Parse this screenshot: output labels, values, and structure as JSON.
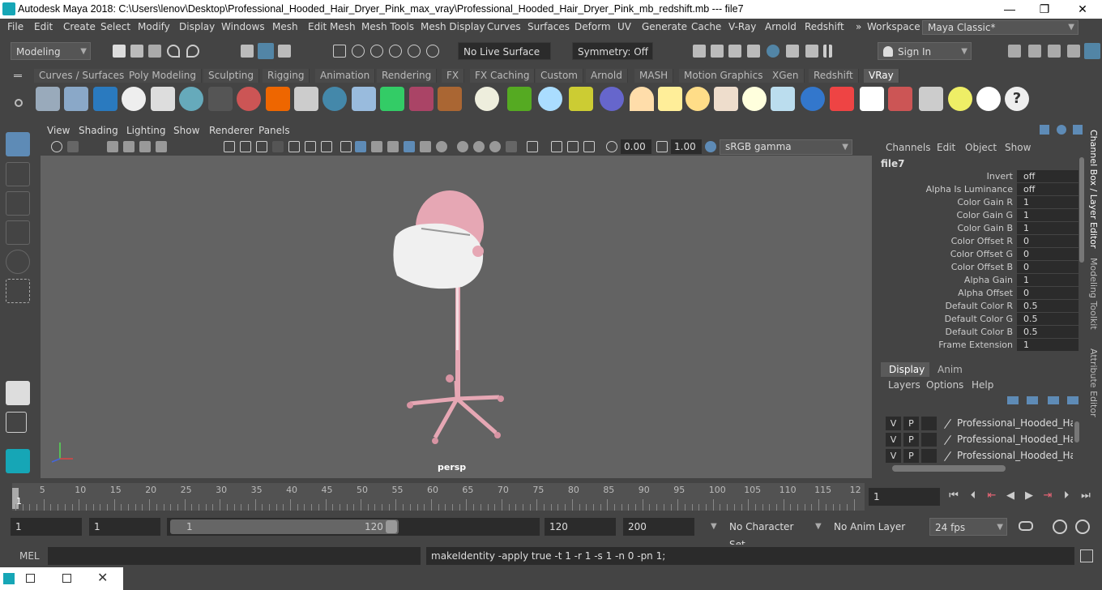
{
  "window": {
    "title": "Autodesk Maya 2018: C:\\Users\\lenov\\Desktop\\Professional_Hooded_Hair_Dryer_Pink_max_vray\\Professional_Hooded_Hair_Dryer_Pink_mb_redshift.mb  ---  file7",
    "minimize": "—",
    "maximize": "❐",
    "close": "✕"
  },
  "menubar": {
    "items": [
      "File",
      "Edit",
      "Create",
      "Select",
      "Modify",
      "Display",
      "Windows",
      "Mesh",
      "Edit Mesh",
      "Mesh Tools",
      "Mesh Display",
      "Curves",
      "Surfaces",
      "Deform",
      "UV",
      "Generate",
      "Cache",
      "V-Ray",
      "Arnold",
      "Redshift"
    ],
    "overflow": "»",
    "workspace_label": "Workspace :",
    "workspace_value": "Maya Classic*"
  },
  "statusline": {
    "mode": "Modeling",
    "live_surface": "No Live Surface",
    "symmetry": "Symmetry: Off",
    "sign_in": "Sign In"
  },
  "shelf": {
    "tabs": [
      "Curves / Surfaces",
      "Poly Modeling",
      "Sculpting",
      "Rigging",
      "Animation",
      "Rendering",
      "FX",
      "FX Caching",
      "Custom",
      "Arnold",
      "MASH",
      "Motion Graphics",
      "XGen",
      "Redshift",
      "VRay"
    ],
    "active": "VRay"
  },
  "viewport": {
    "menus": [
      "View",
      "Shading",
      "Lighting",
      "Show",
      "Renderer",
      "Panels"
    ],
    "exposure": "0.00",
    "gamma": "1.00",
    "colorspace": "sRGB gamma",
    "camera": "persp"
  },
  "channelbox": {
    "tabs": [
      "Channels",
      "Edit",
      "Object",
      "Show"
    ],
    "node": "file7",
    "attrs": [
      {
        "name": "Invert",
        "value": "off"
      },
      {
        "name": "Alpha Is Luminance",
        "value": "off"
      },
      {
        "name": "Color Gain R",
        "value": "1"
      },
      {
        "name": "Color Gain G",
        "value": "1"
      },
      {
        "name": "Color Gain B",
        "value": "1"
      },
      {
        "name": "Color Offset R",
        "value": "0"
      },
      {
        "name": "Color Offset G",
        "value": "0"
      },
      {
        "name": "Color Offset B",
        "value": "0"
      },
      {
        "name": "Alpha Gain",
        "value": "1"
      },
      {
        "name": "Alpha Offset",
        "value": "0"
      },
      {
        "name": "Default Color R",
        "value": "0.5"
      },
      {
        "name": "Default Color G",
        "value": "0.5"
      },
      {
        "name": "Default Color B",
        "value": "0.5"
      },
      {
        "name": "Frame Extension",
        "value": "1"
      }
    ]
  },
  "layers": {
    "tabs": [
      "Display",
      "Anim"
    ],
    "menus": [
      "Layers",
      "Options",
      "Help"
    ],
    "rows": [
      {
        "v": "V",
        "p": "P",
        "name": "Professional_Hooded_Hair_D"
      },
      {
        "v": "V",
        "p": "P",
        "name": "Professional_Hooded_Hair_D"
      },
      {
        "v": "V",
        "p": "P",
        "name": "Professional_Hooded_Hair_D"
      }
    ]
  },
  "sidetabs": [
    "Channel Box / Layer Editor",
    "Modeling Toolkit",
    "Attribute Editor"
  ],
  "timeline": {
    "ticks": [
      "1",
      "5",
      "10",
      "15",
      "20",
      "25",
      "30",
      "35",
      "40",
      "45",
      "50",
      "55",
      "60",
      "65",
      "70",
      "75",
      "80",
      "85",
      "90",
      "95",
      "100",
      "105",
      "110",
      "115",
      "12"
    ],
    "current_frame": "1"
  },
  "range": {
    "start": "1",
    "start_inner": "1",
    "slider_start": "1",
    "slider_end": "120",
    "end_inner": "120",
    "end": "200",
    "character_set": "No Character Set",
    "anim_layer": "No Anim Layer",
    "fps": "24 fps"
  },
  "cmdline": {
    "lang": "MEL",
    "output": "makeIdentity -apply true -t 1 -r 1 -s 1 -n 0 -pn 1;"
  },
  "colors": {
    "accent": "#5285a6",
    "active_tool": "#5e8bb6",
    "panel": "#444444",
    "field": "#2b2b2b",
    "viewport_bg": "#636363",
    "model_pink": "#e6a7b4"
  }
}
